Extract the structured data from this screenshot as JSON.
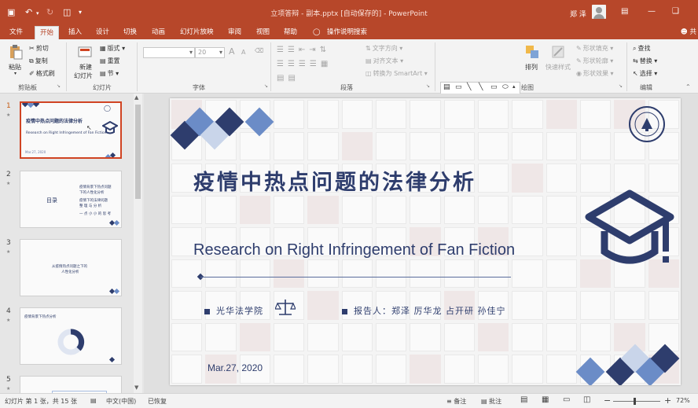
{
  "titlebar": {
    "doc_title": "立项答辩 - 副本.pptx [自动保存的] - PowerPoint",
    "user_name": "郑 泽",
    "quick_save_icon": "save-icon",
    "quick_undo_icon": "undo-icon"
  },
  "tabs": [
    {
      "label": "文件"
    },
    {
      "label": "开始"
    },
    {
      "label": "插入"
    },
    {
      "label": "设计"
    },
    {
      "label": "切换"
    },
    {
      "label": "动画"
    },
    {
      "label": "幻灯片放映"
    },
    {
      "label": "审阅"
    },
    {
      "label": "视图"
    },
    {
      "label": "帮助"
    },
    {
      "label": "操作说明搜索"
    }
  ],
  "share_label": "共",
  "ribbon": {
    "clipboard": {
      "paste": "粘贴",
      "cut": "剪切",
      "copy": "复制",
      "format_painter": "格式刷",
      "group": "剪贴板"
    },
    "slides": {
      "new_slide_1": "新建",
      "new_slide_2": "幻灯片",
      "layout": "版式",
      "reset": "重置",
      "section": "节",
      "group": "幻灯片"
    },
    "font": {
      "size": "20",
      "group": "字体",
      "buttons": [
        "B",
        "I",
        "U",
        "S",
        "abc",
        "AV",
        "Aa",
        "A"
      ],
      "grow": "A",
      "shrink": "A"
    },
    "paragraph": {
      "text_direction": "文字方向",
      "align_text": "对齐文本",
      "smartart": "转换为 SmartArt",
      "group": "段落"
    },
    "drawing": {
      "arrange": "排列",
      "quick_styles": "快速样式",
      "fill": "形状填充",
      "outline": "形状轮廓",
      "effects": "形状效果",
      "group": "绘图"
    },
    "editing": {
      "find": "查找",
      "replace": "替换",
      "select": "选择",
      "group": "编辑"
    }
  },
  "thumbnails": [
    {
      "num": "1",
      "title": "疫情中热点问题的法律分析",
      "sub": "Research on Right Infringement of Fan Fiction"
    },
    {
      "num": "2",
      "heading": "目录",
      "lines": [
        "疫情背景下热点问题",
        "下的人性化分析",
        "疫情下的法律问题",
        "整 理 与 分 析",
        "一 点 小 小 的 思 考"
      ]
    },
    {
      "num": "3",
      "lines": [
        "从疫情热点问题之下的",
        "人性化分析"
      ]
    },
    {
      "num": "4",
      "lines": [
        "疫情背景下热点分析"
      ]
    },
    {
      "num": "5"
    }
  ],
  "slide": {
    "title": "疫情中热点问题的法律分析",
    "subtitle": "Research on Right Infringement of Fan Fiction",
    "school": "光华法学院",
    "reporters": "报告人：郑泽 厉华龙 占开研 孙佳宁",
    "date": "Mar.27, 2020",
    "logo_text": "浙江大学"
  },
  "status": {
    "slide_info": "幻灯片 第 1 张，共 15 张",
    "language": "中文(中国)",
    "recovered": "已恢复",
    "notes": "备注",
    "comments": "批注",
    "zoom": "72%"
  },
  "colors": {
    "accent": "#b7472a",
    "navy": "#2e3d6d",
    "mid_blue": "#6b8cc7",
    "light_blue": "#c9d5ea"
  }
}
